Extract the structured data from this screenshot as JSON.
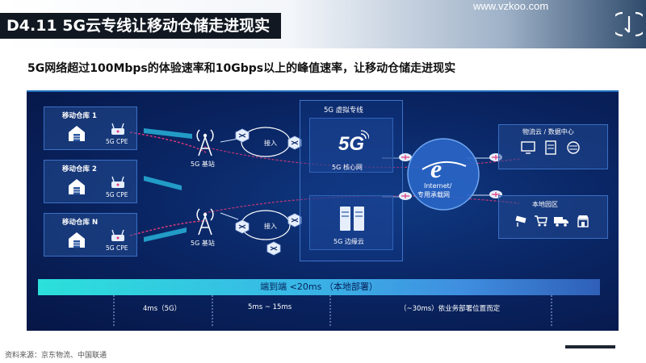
{
  "header": {
    "title": "D4.11 5G云专线让移动仓储走进现实",
    "url": "www.vzkoo.com"
  },
  "subtitle": "5G网络超过100Mbps的体验速率和10Gbps以上的峰值速率，让移动仓储走进现实",
  "diagram": {
    "warehouses": [
      {
        "name": "移动仓库 1",
        "cpe": "5G CPE"
      },
      {
        "name": "移动仓库 2",
        "cpe": "5G CPE"
      },
      {
        "name": "移动仓库 N",
        "cpe": "5G CPE"
      }
    ],
    "base_station": "5G 基站",
    "access": "接入",
    "virtual_line": "5G 虚拟专线",
    "core_net": "5G 核心网",
    "edge_cloud": "5G 边缘云",
    "internet": "Internet/",
    "carrier_net": "专用承载网",
    "logistics_cloud": "物流云 / 数据中心",
    "local_park": "本地园区",
    "bar_text": "端到端 <20ms （本地部署）",
    "latencies": [
      "4ms（5G）",
      "5ms ~ 15ms",
      "（~30ms）依业务部署位置而定"
    ]
  },
  "source": "资料来源：京东物流、中国联通",
  "colors": {
    "panel_bg": "#0a2665",
    "accent_cyan": "#2be0da",
    "signal_pink": "#e0397a",
    "header_dark": "#111821"
  }
}
